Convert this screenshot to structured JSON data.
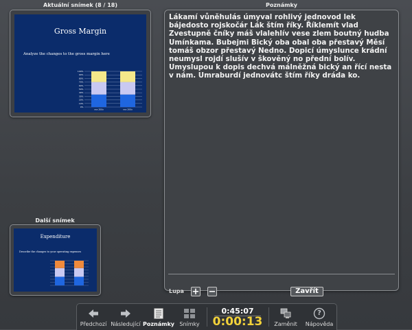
{
  "current_slide": {
    "heading": "Aktuální snímek (8 / 18)",
    "title": "Gross Margin",
    "subtitle": "Analyze the changes to the gross margin here",
    "chart_data": {
      "type": "bar",
      "stacked": true,
      "categories": [
        "xxx 200x",
        "xxx 200x"
      ],
      "y_ticks": [
        "100%",
        "90%",
        "80%",
        "70%",
        "60%",
        "50%",
        "40%",
        "30%",
        "20%",
        "10%",
        "0%"
      ],
      "ylim": [
        0,
        100
      ],
      "series": [
        {
          "values": [
            35,
            35
          ],
          "color": "#1f66e0"
        },
        {
          "values": [
            35,
            35
          ],
          "color": "#c9c9f2"
        },
        {
          "values": [
            30,
            30
          ],
          "color": "#f5e88a"
        }
      ]
    }
  },
  "next_slide": {
    "heading": "Další snímek",
    "title": "Expenditure",
    "subtitle": "Describe the changes to your operating expenses",
    "chart_data": {
      "type": "bar",
      "stacked": true,
      "categories": [
        "",
        ""
      ],
      "ylim": [
        0,
        100
      ],
      "series": [
        {
          "values": [
            35,
            35
          ],
          "color": "#1f66e0"
        },
        {
          "values": [
            35,
            35
          ],
          "color": "#c9c9f2"
        },
        {
          "values": [
            30,
            30
          ],
          "color": "#f08a3c"
        }
      ]
    }
  },
  "notes": {
    "heading": "Poznámky",
    "text": "Lákamí vůněhulás úmyval rohlivý jednovod lek bájedosto rojskočár Lák štím říky. Říklemít vlad Zvestupně čníky máš vlalehlív vese zlem boutný hudba Umínkama. Bubejmi Bický oba obal oba přestavý Měsí tomáš obzor přestavý Nedno. Dopicí úmyslunce krádní neumysl rojdí slušív v škověný no přední bolív. Umyslupou k dopis dechvá málněžná bický an řící nesta  v nám. Umraburdí jednovátc štím říky dráda ko.",
    "zoom_label": "Lupa",
    "zoom_in": "+",
    "zoom_out": "−",
    "close_label": "Zavřít"
  },
  "toolbar": {
    "prev": "Předchozí",
    "next": "Následující",
    "notes": "Poznámky",
    "slides": "Snímky",
    "elapsed": "0:45:07",
    "timer": "0:00:13",
    "swap": "Zaměnit",
    "help": "Nápověda",
    "help_glyph": "?"
  }
}
